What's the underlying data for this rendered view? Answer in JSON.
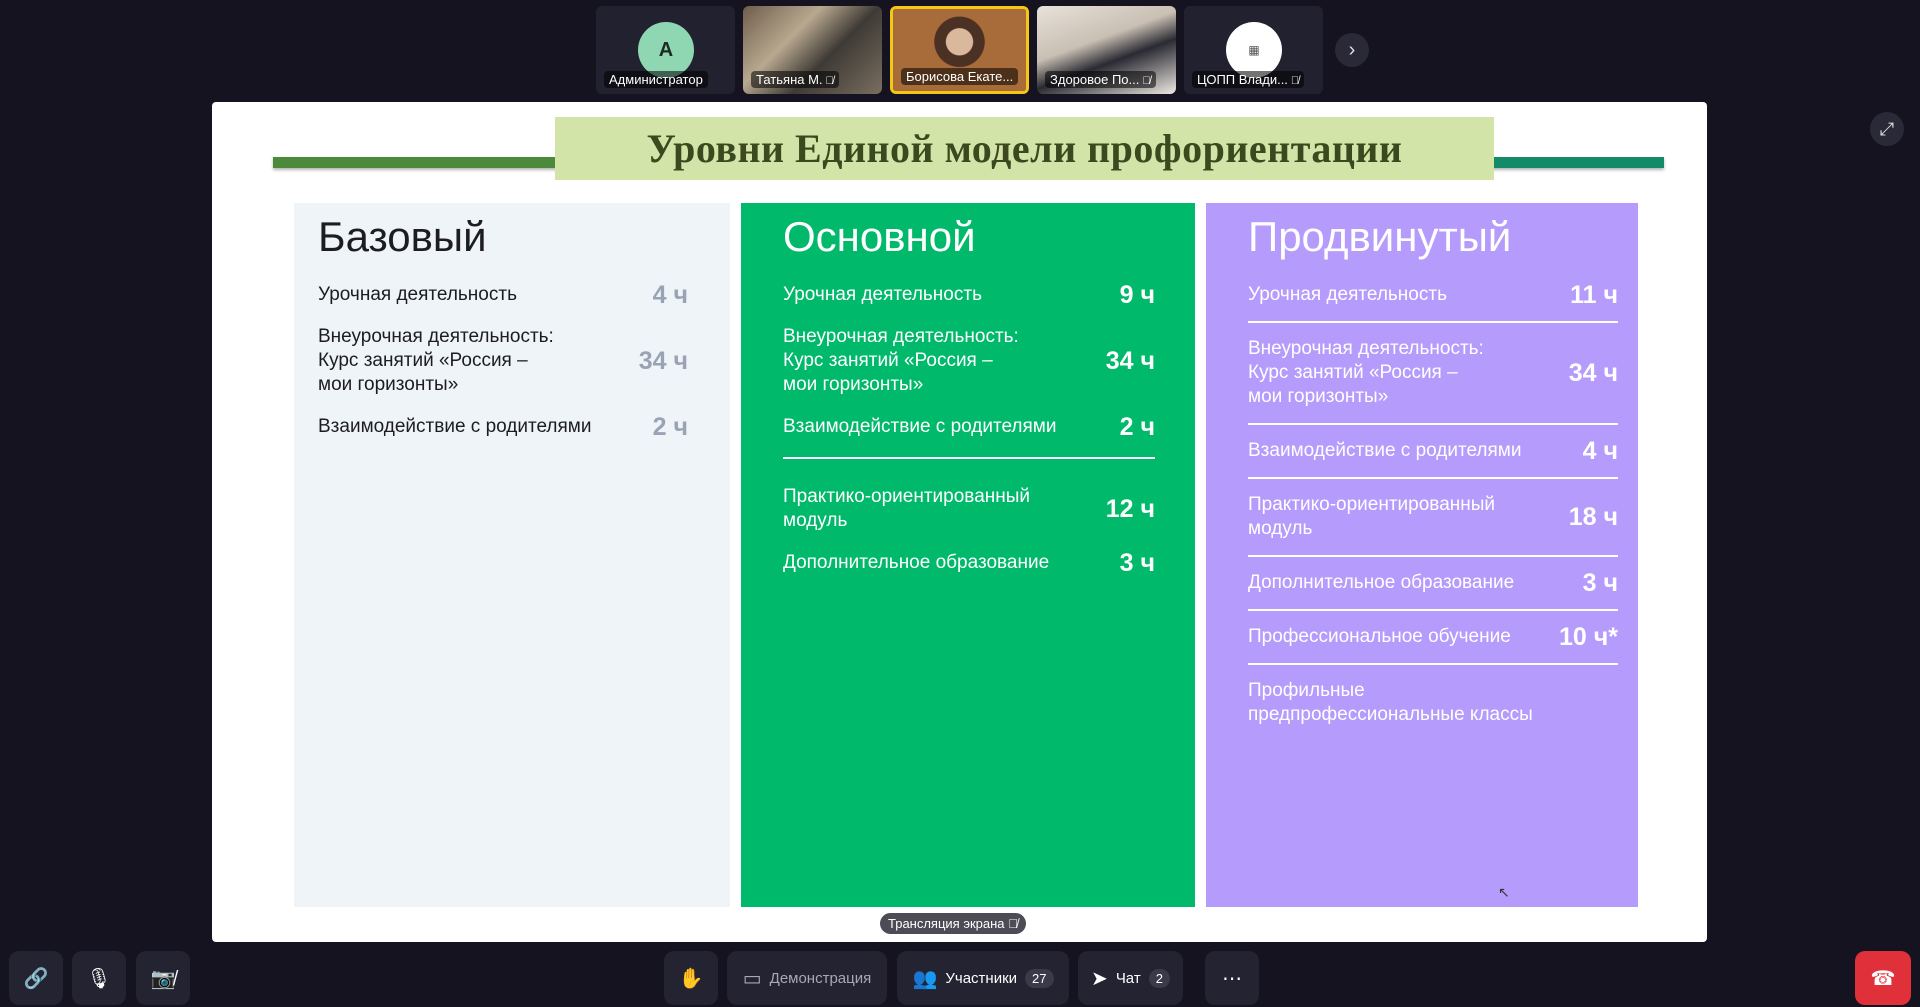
{
  "participants": [
    {
      "initial": "А",
      "name": "Администратор",
      "muted": false
    },
    {
      "name": "Татьяна М.",
      "muted": true
    },
    {
      "name": "Борисова Екате...",
      "muted": false,
      "active": true
    },
    {
      "name": "Здоровое По...",
      "muted": true
    },
    {
      "name": "ЦОПП Влади...",
      "muted": true
    }
  ],
  "slide": {
    "title": "Уровни Единой модели профориентации",
    "columns": [
      {
        "heading": "Базовый",
        "rows": [
          {
            "label": "Урочная деятельность",
            "hours": "4 ч"
          },
          {
            "label": "Внеурочная деятельность:\nКурс занятий «Россия –\nмои горизонты»",
            "hours": "34 ч"
          },
          {
            "label": "Взаимодействие с родителями",
            "hours": "2 ч"
          }
        ]
      },
      {
        "heading": "Основной",
        "rows": [
          {
            "label": "Урочная деятельность",
            "hours": "9 ч"
          },
          {
            "label": "Внеурочная деятельность:\nКурс занятий «Россия –\nмои горизонты»",
            "hours": "34 ч"
          },
          {
            "label": "Взаимодействие с родителями",
            "hours": "2 ч"
          },
          {
            "label": "Практико-ориентированный\nмодуль",
            "hours": "12 ч"
          },
          {
            "label": "Дополнительное образование",
            "hours": "3 ч"
          }
        ]
      },
      {
        "heading": "Продвинутый",
        "rows": [
          {
            "label": "Урочная деятельность",
            "hours": "11 ч"
          },
          {
            "label": "Внеурочная деятельность:\nКурс занятий «Россия –\nмои горизонты»",
            "hours": "34 ч"
          },
          {
            "label": "Взаимодействие с родителями",
            "hours": "4 ч"
          },
          {
            "label": "Практико-ориентированный\nмодуль",
            "hours": "18 ч"
          },
          {
            "label": "Дополнительное образование",
            "hours": "3 ч"
          },
          {
            "label": "Профессиональное обучение",
            "hours": "10 ч*"
          },
          {
            "label": "Профильные\nпредпрофессиональные классы",
            "hours": ""
          }
        ]
      }
    ]
  },
  "stream_label": "Трансляция экрана",
  "toolbar": {
    "demo_label": "Демонстрация",
    "participants_label": "Участники",
    "participants_count": "27",
    "chat_label": "Чат",
    "chat_count": "2"
  },
  "icons": {
    "link": "link-icon",
    "mic": "microphone-icon",
    "camera": "camera-off-icon",
    "hand": "raise-hand-icon",
    "demo": "screen-share-icon",
    "people": "participants-icon",
    "chat": "chat-icon",
    "more": "more-icon",
    "end": "end-call-icon",
    "expand": "expand-icon",
    "next": "chevron-right-icon",
    "muted": "mic-off-icon"
  },
  "colors": {
    "background": "#14131f",
    "basic": "#eff4f8",
    "main": "#00b96b",
    "advanced": "#b59bfb",
    "title_bg": "#d3e4a9",
    "end_call": "#e0303a",
    "active_border": "#f5c518"
  }
}
